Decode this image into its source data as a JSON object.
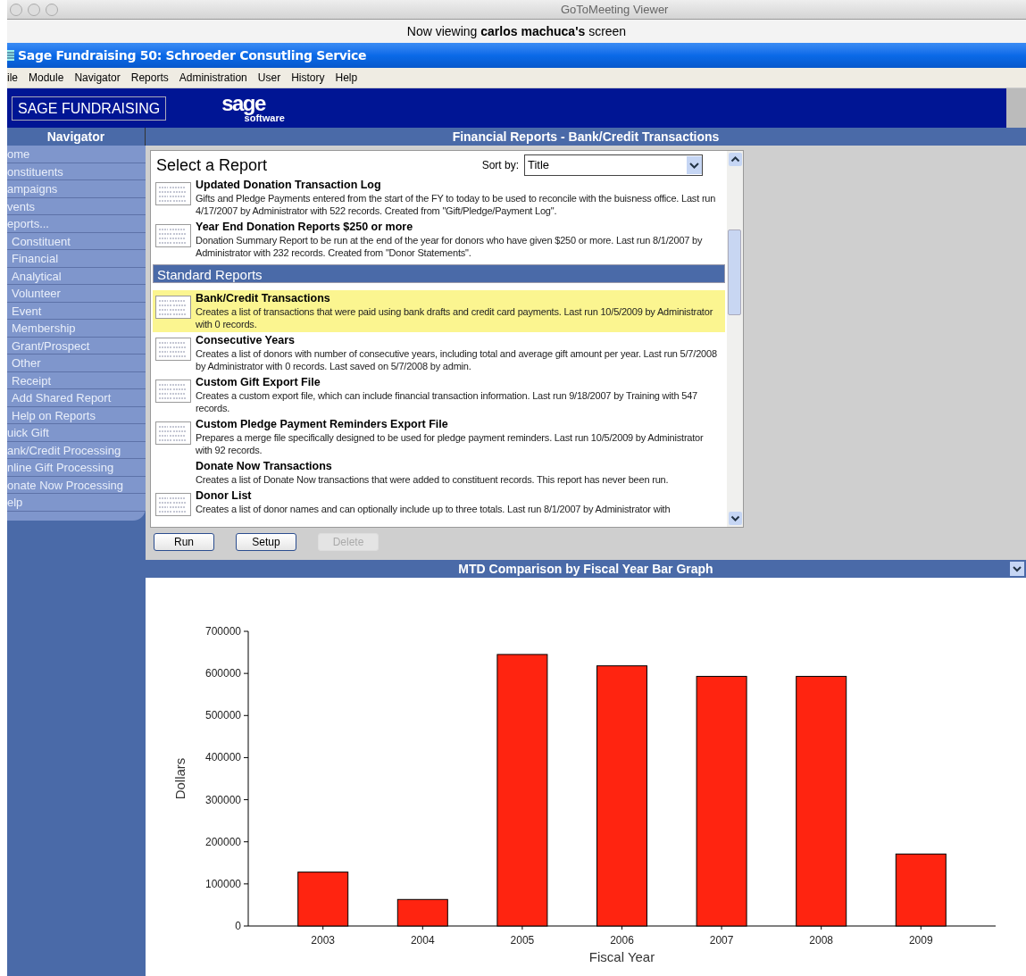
{
  "window": {
    "title": "GoToMeeting Viewer"
  },
  "viewer_banner": "Now viewing **carlos machuca's** screen",
  "app": {
    "title": "Sage Fundraising 50:  Schroeder Consutling Service",
    "menu": [
      "ile",
      "Module",
      "Navigator",
      "Reports",
      "Administration",
      "User",
      "History",
      "Help"
    ],
    "brand": "SAGE FUNDRAISING",
    "logo": {
      "word": "sage",
      "sub": "software"
    }
  },
  "navigator": {
    "title": "Navigator",
    "items": [
      {
        "label": "ome"
      },
      {
        "label": "onstituents"
      },
      {
        "label": "ampaigns"
      },
      {
        "label": "vents"
      },
      {
        "label": "eports...",
        "children": [
          {
            "label": "Constituent"
          },
          {
            "label": "Financial"
          },
          {
            "label": "Analytical"
          },
          {
            "label": "Volunteer"
          },
          {
            "label": "Event"
          },
          {
            "label": "Membership"
          },
          {
            "label": "Grant/Prospect"
          },
          {
            "label": "Other"
          },
          {
            "label": "Receipt"
          },
          {
            "label": "Add Shared Report"
          },
          {
            "label": "Help on Reports"
          }
        ]
      },
      {
        "label": "uick Gift"
      },
      {
        "label": "ank/Credit Processing"
      },
      {
        "label": "nline Gift Processing"
      },
      {
        "label": "onate Now Processing"
      },
      {
        "label": "elp"
      }
    ]
  },
  "reports_panel": {
    "title": "Financial Reports - Bank/Credit Transactions",
    "heading": "Select a Report",
    "sort_label": "Sort by:",
    "sort_value": "Title",
    "items": [
      {
        "kind": "report",
        "has_icon": true,
        "selected": false,
        "title": "Updated Donation Transaction Log",
        "description": "Gifts and Pledge Payments entered from the start of the FY to today to be used to reconcile with the buisness office. Last run 4/17/2007 by Administrator with 522 records.  Created from \"Gift/Pledge/Payment Log\"."
      },
      {
        "kind": "report",
        "has_icon": true,
        "selected": false,
        "title": "Year End Donation Reports $250 or more",
        "description": "Donation Summary Report to be run at the end of the year for donors who have given $250 or more. Last run 8/1/2007 by Administrator with 232 records.  Created from \"Donor Statements\"."
      },
      {
        "kind": "section",
        "title": "Standard Reports"
      },
      {
        "kind": "report",
        "has_icon": true,
        "selected": true,
        "title": "Bank/Credit Transactions",
        "description": "Creates a list of transactions that were paid using bank drafts and credit card payments. Last run 10/5/2009 by Administrator with 0 records."
      },
      {
        "kind": "report",
        "has_icon": true,
        "selected": false,
        "title": "Consecutive Years",
        "description": "Creates a list of donors with number of consecutive years, including total and average gift amount per year. Last run 5/7/2008 by Administrator with 0 records.  Last saved on 5/7/2008 by admin."
      },
      {
        "kind": "report",
        "has_icon": true,
        "selected": false,
        "title": "Custom Gift Export File",
        "description": "Creates a custom export file, which can include financial transaction information. Last run 9/18/2007 by Training with 547 records."
      },
      {
        "kind": "report",
        "has_icon": true,
        "selected": false,
        "title": "Custom Pledge Payment Reminders Export File",
        "description": "Prepares a merge file specifically designed to be used for pledge payment reminders. Last run 10/5/2009 by Administrator with 92 records."
      },
      {
        "kind": "report",
        "has_icon": false,
        "selected": false,
        "title": "Donate Now Transactions",
        "description": "Creates a list of Donate Now transactions that were added to constituent records. This report has never been run."
      },
      {
        "kind": "report",
        "has_icon": true,
        "selected": false,
        "title": "Donor List",
        "description": "Creates a list of donor names and can optionally include up to three totals. Last run 8/1/2007 by Administrator with"
      }
    ],
    "buttons": [
      {
        "label": "Run",
        "disabled": false
      },
      {
        "label": "Setup",
        "disabled": false
      },
      {
        "label": "Delete",
        "disabled": true
      }
    ]
  },
  "graph_panel": {
    "title": "MTD Comparison by Fiscal Year Bar Graph",
    "chart_data": {
      "type": "bar",
      "xlabel": "Fiscal Year",
      "ylabel": "Dollars",
      "categories": [
        "2003",
        "2004",
        "2005",
        "2006",
        "2007",
        "2008",
        "2009"
      ],
      "series": [
        {
          "color": "#ff2410",
          "values": [
            128000,
            63000,
            645000,
            618000,
            593000,
            593000,
            171000
          ]
        }
      ],
      "ylim": [
        0,
        700000
      ],
      "yticks": [
        0,
        100000,
        200000,
        300000,
        400000,
        500000,
        600000,
        700000
      ]
    }
  }
}
